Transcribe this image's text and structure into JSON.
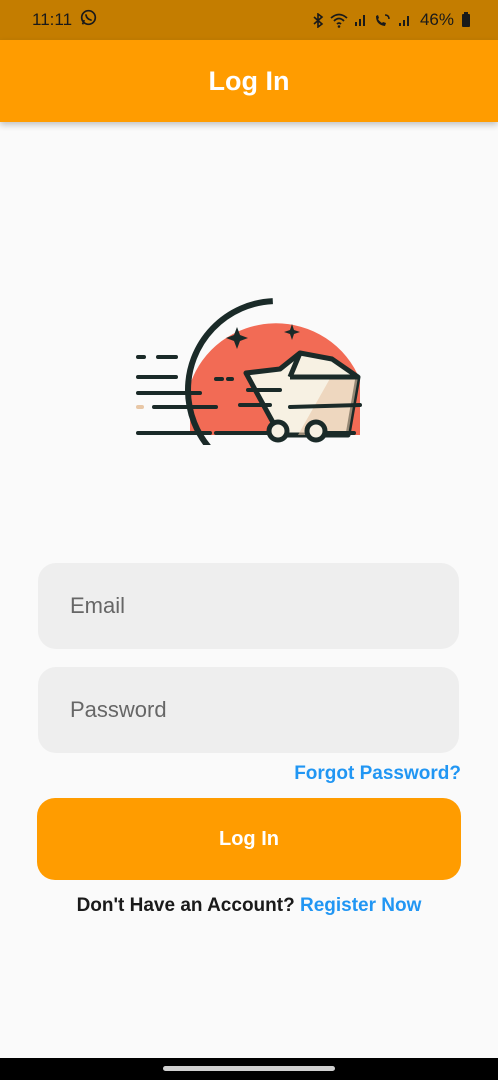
{
  "status_bar": {
    "time": "11:11",
    "battery": "46%"
  },
  "app_bar": {
    "title": "Log In"
  },
  "form": {
    "email_placeholder": "Email",
    "password_placeholder": "Password",
    "forgot_password": "Forgot Password?",
    "login_button": "Log In"
  },
  "register": {
    "prompt": "Don't Have an Account?",
    "link": "Register Now"
  },
  "colors": {
    "primary": "#ff9c00",
    "status_bar": "#c47d00",
    "link": "#2196f3",
    "field_bg": "#eeeeee",
    "logo_circle": "#f26b55"
  },
  "icons": [
    "whatsapp-icon",
    "bluetooth-icon",
    "wifi-icon",
    "signal-icon",
    "call-icon",
    "battery-icon",
    "delivery-truck-logo-icon"
  ]
}
